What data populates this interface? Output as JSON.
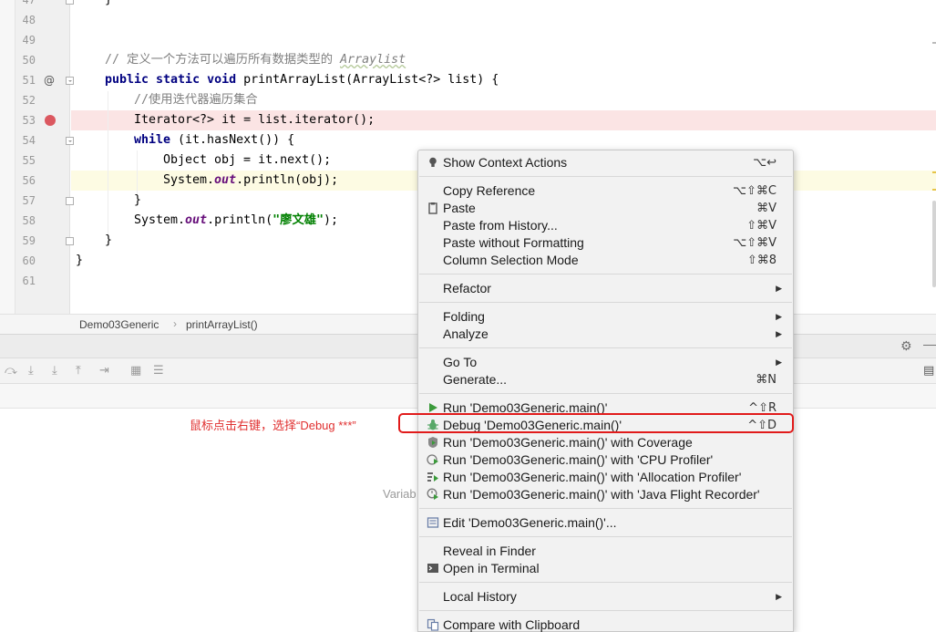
{
  "editor": {
    "lines": [
      {
        "num": "47"
      },
      {
        "num": "48"
      },
      {
        "num": "49"
      },
      {
        "num": "50"
      },
      {
        "num": "51"
      },
      {
        "num": "52"
      },
      {
        "num": "53"
      },
      {
        "num": "54"
      },
      {
        "num": "55"
      },
      {
        "num": "56"
      },
      {
        "num": "57"
      },
      {
        "num": "58"
      },
      {
        "num": "59"
      },
      {
        "num": "60"
      },
      {
        "num": "61"
      }
    ],
    "code": {
      "l47_brace": "}",
      "l50_comment": "// 定义一个方法可以遍历所有数据类型的 ",
      "l50_comment_italic": "Arraylist",
      "l51_kw": "public static void ",
      "l51_rest": "printArrayList(ArrayList<?> list) {",
      "l52_comment": "//使用迭代器遍历集合",
      "l53": "Iterator<?> it = list.iterator();",
      "l54_kw": "while",
      "l54_rest": " (it.hasNext()) {",
      "l55": "Object obj = it.next();",
      "l56_a": "System.",
      "l56_field": "out",
      "l56_b": ".println(obj);",
      "l57": "}",
      "l58_a": "System.",
      "l58_field": "out",
      "l58_b": ".println(",
      "l58_str": "\"廖文雄\"",
      "l58_c": ");",
      "l59": "}",
      "l60": "}"
    },
    "override_marker": "@"
  },
  "breadcrumb": {
    "class_name": "Demo03Generic",
    "separator": "›",
    "method_name": "printArrayList()"
  },
  "debug_panel": {
    "variables_placeholder": "Variab",
    "annotation": "鼠标点击右键，选择“Debug ***”"
  },
  "context_menu": {
    "items": [
      {
        "label": "Show Context Actions",
        "shortcut": "⌥↩",
        "icon": "lightbulb-icon"
      },
      {
        "label": "Copy Reference",
        "shortcut": "⌥⇧⌘C"
      },
      {
        "label": "Paste",
        "shortcut": "⌘V",
        "icon": "clipboard-icon"
      },
      {
        "label": "Paste from History...",
        "shortcut": "⇧⌘V"
      },
      {
        "label": "Paste without Formatting",
        "shortcut": "⌥⇧⌘V"
      },
      {
        "label": "Column Selection Mode",
        "shortcut": "⇧⌘8"
      },
      {
        "label": "Refactor",
        "submenu": true
      },
      {
        "label": "Folding",
        "submenu": true
      },
      {
        "label": "Analyze",
        "submenu": true
      },
      {
        "label": "Go To",
        "submenu": true
      },
      {
        "label": "Generate...",
        "shortcut": "⌘N"
      },
      {
        "label": "Run 'Demo03Generic.main()'",
        "shortcut": "^⇧R",
        "icon": "run-icon"
      },
      {
        "label": "Debug 'Demo03Generic.main()'",
        "shortcut": "^⇧D",
        "icon": "debug-icon"
      },
      {
        "label": "Run 'Demo03Generic.main()' with Coverage",
        "icon": "coverage-icon"
      },
      {
        "label": "Run 'Demo03Generic.main()' with 'CPU Profiler'",
        "icon": "cpu-profiler-icon"
      },
      {
        "label": "Run 'Demo03Generic.main()' with 'Allocation Profiler'",
        "icon": "allocation-profiler-icon"
      },
      {
        "label": "Run 'Demo03Generic.main()' with 'Java Flight Recorder'",
        "icon": "flight-recorder-icon"
      },
      {
        "label": "Edit 'Demo03Generic.main()'...",
        "icon": "edit-config-icon"
      },
      {
        "label": "Reveal in Finder"
      },
      {
        "label": "Open in Terminal",
        "icon": "terminal-icon"
      },
      {
        "label": "Local History",
        "submenu": true
      },
      {
        "label": "Compare with Clipboard",
        "icon": "compare-icon"
      }
    ],
    "submenu_arrow": "▶"
  },
  "colors": {
    "highlight_box": "#e11b1b",
    "breakpoint": "#db5860",
    "keyword": "#000080",
    "string": "#008000",
    "run_green": "#3a9a3a",
    "debug_green": "#59a869"
  }
}
